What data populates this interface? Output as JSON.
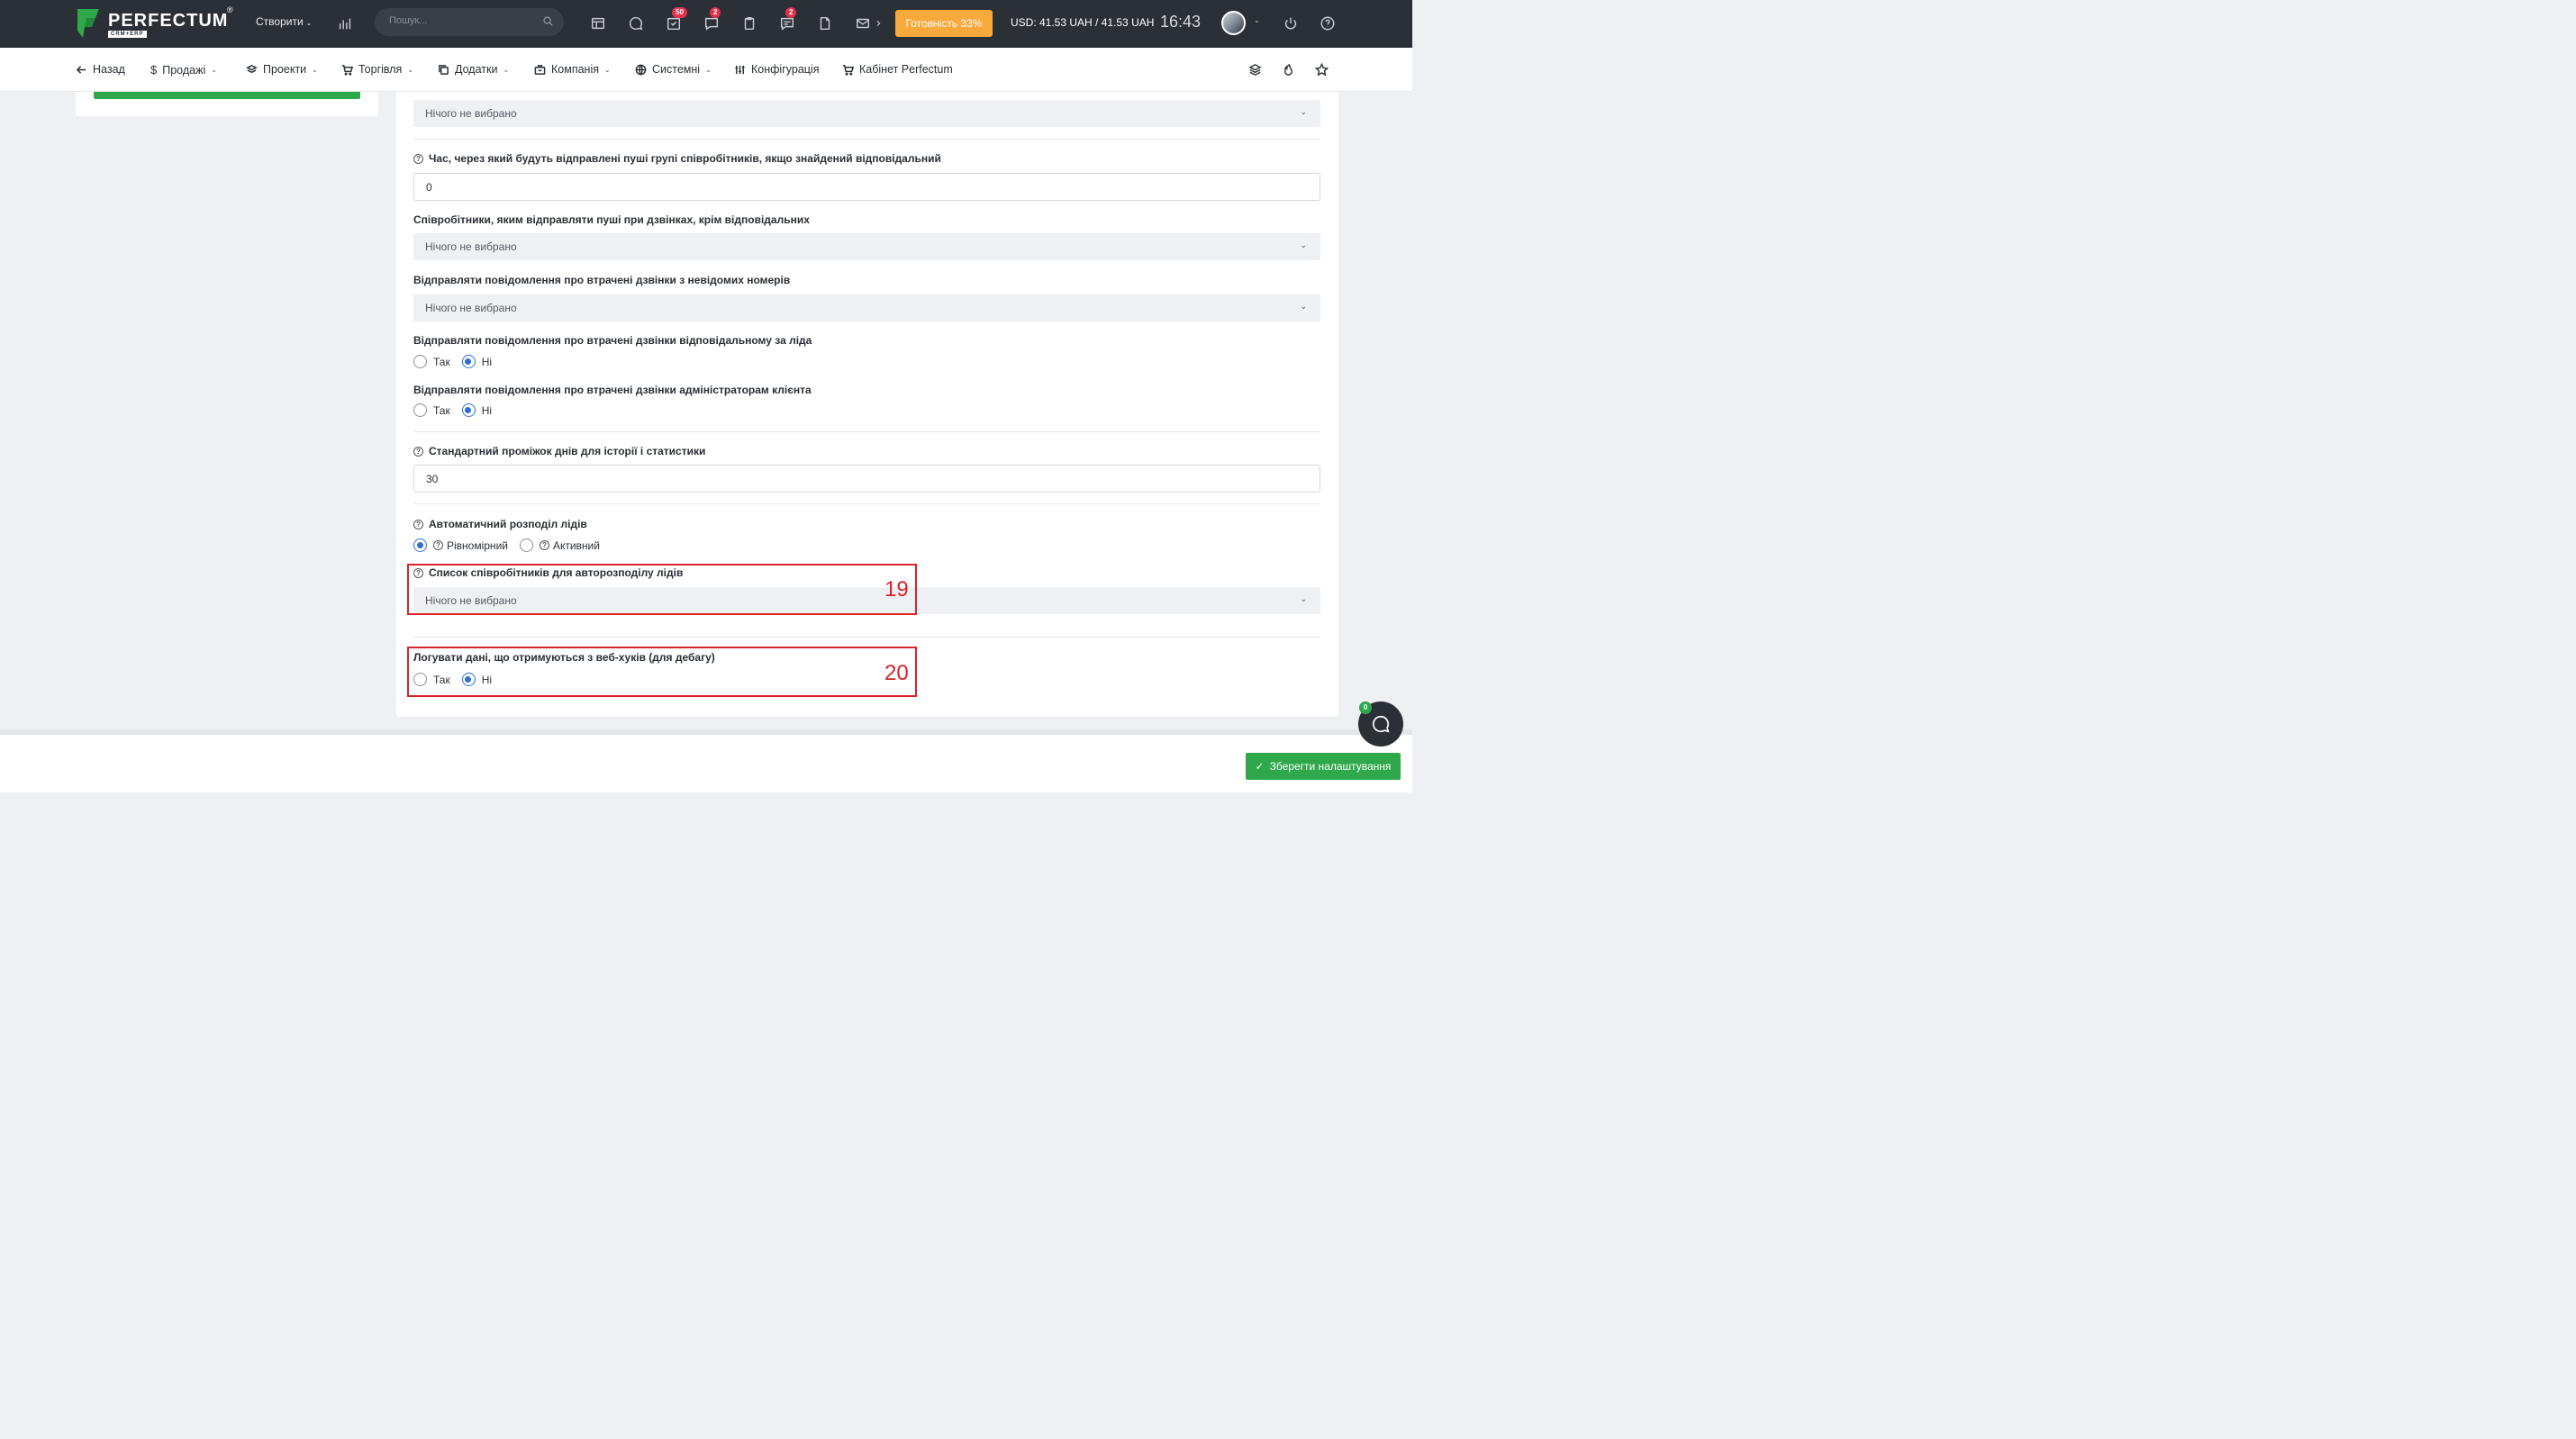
{
  "app": {
    "logo_text": "PERFECTUM",
    "logo_sub": "CRM+ERP",
    "logo_reg": "®"
  },
  "topbar": {
    "create_label": "Створити",
    "search_placeholder": "Пошук...",
    "badges": {
      "tasks": "50",
      "chat": "2",
      "messages": "2"
    },
    "ready_label": "Готовність 33%",
    "currency": "USD: 41.53 UAH / 41.53 UAH",
    "time": "16:43",
    "icons": [
      "bar-chart-icon",
      "search-icon",
      "table-icon",
      "comment-icon",
      "tasks-icon",
      "chat-icon",
      "clipboard-icon",
      "messages-icon",
      "file-icon",
      "mail-icon",
      "power-icon",
      "help-icon"
    ]
  },
  "nav": {
    "back": "Назад",
    "sales": "Продажі",
    "projects": "Проекти",
    "trade": "Торгівля",
    "addons": "Додатки",
    "company": "Компанія",
    "system": "Системні",
    "config": "Конфігурація",
    "cabinet": "Кабінет Perfectum"
  },
  "form": {
    "select_top": {
      "value": "Нічого не вибрано"
    },
    "push_delay": {
      "label": "Час, через який будуть відправлені пуші групі співробітників, якщо знайдений відповідальний",
      "value": "0"
    },
    "push_employees": {
      "label": "Співробітники, яким відправляти пуші при дзвінках, крім відповідальних",
      "value": "Нічого не вибрано"
    },
    "missed_unknown": {
      "label": "Відправляти повідомлення про втрачені дзвінки з невідомих номерів",
      "value": "Нічого не вибрано"
    },
    "missed_lead_owner": {
      "label": "Відправляти повідомлення про втрачені дзвінки відповідальному за ліда",
      "yes": "Так",
      "no": "Ні",
      "selected": "no"
    },
    "missed_client_admins": {
      "label": "Відправляти повідомлення про втрачені дзвінки адміністраторам клієнта",
      "yes": "Так",
      "no": "Ні",
      "selected": "no"
    },
    "history_days": {
      "label": "Стандартний проміжок днів для історії і статистики",
      "value": "30"
    },
    "auto_distribution": {
      "label": "Автоматичний розподіл лідів",
      "option_even": "Рівномірний",
      "option_active": "Активний",
      "selected": "even"
    },
    "distribution_list": {
      "label": "Список співробітників для авторозподілу лідів",
      "value": "Нічого не вибрано"
    },
    "log_webhooks": {
      "label": "Логувати дані, що отримуються з веб-хуків (для дебагу)",
      "yes": "Так",
      "no": "Ні",
      "selected": "no"
    }
  },
  "annotations": {
    "box19": "19",
    "box20": "20",
    "color": "#d9222a"
  },
  "footer": {
    "save_label": "Зберегти налаштування",
    "chat_badge": "0"
  },
  "colors": {
    "accent_green": "#2ea84a",
    "ready_orange": "#f7a93b",
    "topbar": "#2b2f36",
    "radio_blue": "#2f6fd6",
    "badge_red": "#e0334c"
  }
}
